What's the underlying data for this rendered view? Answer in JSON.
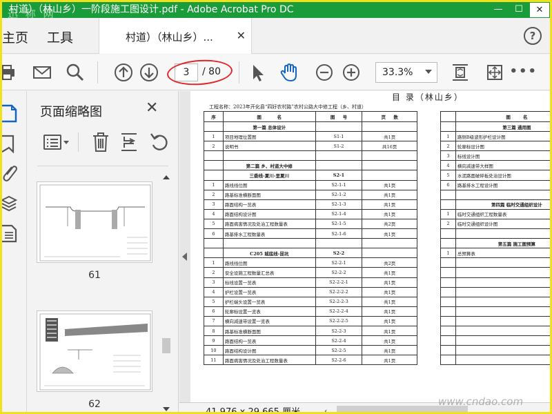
{
  "window": {
    "title": "村道）（林山乡）一阶段施工图设计.pdf - Adobe Acrobat Pro DC",
    "watermark": "迅 称 网",
    "minimize": "—",
    "maximize": "☐",
    "close": "✕",
    "accent": "#1a9c3a"
  },
  "tabs": {
    "home": "主页",
    "tools": "工具",
    "doc": "村道）（林山乡）...",
    "doc_close": "✕",
    "help": "?"
  },
  "toolbar": {
    "icons": [
      "print-icon",
      "email-icon",
      "search-icon",
      "page-up-icon",
      "page-down-icon",
      "select-cursor-icon",
      "hand-tool-icon",
      "zoom-out-icon",
      "zoom-in-icon",
      "fit-page-icon",
      "full-screen-icon",
      "more-icon"
    ],
    "page_current": "3",
    "page_total": "/ 80",
    "zoom": "33.3%",
    "more": "•••",
    "highlight_color": "#e0262a"
  },
  "thumbnails": {
    "header": "页面缩略图",
    "close": "✕",
    "tool_icons": [
      "options-icon",
      "delete-icon",
      "extract-icon",
      "rotate-icon"
    ],
    "pages": [
      {
        "label": "61"
      },
      {
        "label": "62"
      }
    ]
  },
  "document": {
    "heading": "目  录（林山乡）",
    "project_name": "工程名称：2023年开化县“四好农村路”农村公路大中修工程（乡、村道）",
    "left_table": {
      "headers": [
        "序",
        "图",
        "名",
        "图",
        "号",
        "页",
        "数"
      ],
      "rows": [
        {
          "type": "sec",
          "name": "第一篇  总体设计"
        },
        {
          "no": "1",
          "name": "项目地理位置图",
          "code": "S1-1",
          "pages": "共1页"
        },
        {
          "no": "2",
          "name": "说明书",
          "code": "S1-2",
          "pages": "共16页"
        },
        {
          "type": "blank"
        },
        {
          "type": "sec",
          "name": "第二篇  乡、村道大中修"
        },
        {
          "type": "sub",
          "name": "三委线-夏川-里夏川",
          "code": "S2-1"
        },
        {
          "no": "1",
          "name": "路线线位图",
          "code": "S2-1-1",
          "pages": "共1页"
        },
        {
          "no": "2",
          "name": "路基标准横断面图",
          "code": "S2-1-2",
          "pages": "共1页"
        },
        {
          "no": "3",
          "name": "路面结构一览表",
          "code": "S2-1-3",
          "pages": "共1页"
        },
        {
          "no": "4",
          "name": "路面结构设计图",
          "code": "S2-1-4",
          "pages": "共1页"
        },
        {
          "no": "5",
          "name": "路面病害情况及处治工程数量表",
          "code": "S2-1-5",
          "pages": "共2页"
        },
        {
          "no": "6",
          "name": "路基排水工程数量表",
          "code": "S2-1-6",
          "pages": "共1页"
        },
        {
          "type": "blank"
        },
        {
          "type": "sub",
          "name": "C205  城底线-昆坑",
          "code": "S2-2"
        },
        {
          "no": "1",
          "name": "路线线位图",
          "code": "S2-2-1",
          "pages": "共2页"
        },
        {
          "no": "2",
          "name": "安全设施工程数量汇总表",
          "code": "S2-2-2",
          "pages": "共1页"
        },
        {
          "no": "3",
          "name": "标线设置一览表",
          "code": "S2-2-2-1",
          "pages": "共1页"
        },
        {
          "no": "4",
          "name": "护栏设置一览表",
          "code": "S2-2-2-2",
          "pages": "共1页"
        },
        {
          "no": "5",
          "name": "护栏端头设置一览表",
          "code": "S2-2-2-3",
          "pages": "共1页"
        },
        {
          "no": "6",
          "name": "轮廓标设置一览表",
          "code": "S2-2-2-4",
          "pages": "共1页"
        },
        {
          "no": "7",
          "name": "横向减速带设置一览表",
          "code": "S2-2-2-5",
          "pages": "共1页"
        },
        {
          "no": "8",
          "name": "路基标准横断面图",
          "code": "S2-2-3",
          "pages": "共1页"
        },
        {
          "no": "9",
          "name": "路面结构一览表",
          "code": "S2-2-4",
          "pages": "共1页"
        },
        {
          "no": "10",
          "name": "路面结构设计图",
          "code": "S2-2-5",
          "pages": "共1页"
        },
        {
          "no": "11",
          "name": "路面病害情况及处治工程数量表",
          "code": "S2-2-6",
          "pages": "共1页"
        }
      ]
    },
    "right_table": {
      "headers": [
        "",
        "图",
        "名"
      ],
      "rows": [
        {
          "type": "sec",
          "name": "第三篇  通用图"
        },
        {
          "no": "1",
          "name": "路侧B级波形护栏设计图"
        },
        {
          "no": "2",
          "name": "轮廓标设计图"
        },
        {
          "no": "3",
          "name": "标线设计图"
        },
        {
          "no": "4",
          "name": "横向减速带大样图"
        },
        {
          "no": "5",
          "name": "水泥路面破碎板处治设计图"
        },
        {
          "no": "6",
          "name": "路基排水工程设计图"
        },
        {
          "type": "blank"
        },
        {
          "type": "sec",
          "name": "第四篇  临时交通组织设计"
        },
        {
          "no": "1",
          "name": "临时交通组织工程数量表"
        },
        {
          "no": "2",
          "name": "临时交通组织设计图"
        },
        {
          "type": "blank"
        },
        {
          "type": "sec",
          "name": "第五篇  施工图预算"
        },
        {
          "no": "1",
          "name": "总预算表"
        },
        {
          "type": "blank"
        },
        {
          "type": "blank"
        },
        {
          "type": "blank"
        },
        {
          "type": "blank"
        },
        {
          "type": "blank"
        },
        {
          "type": "blank"
        },
        {
          "type": "blank"
        },
        {
          "type": "blank"
        },
        {
          "type": "blank"
        },
        {
          "type": "blank"
        },
        {
          "type": "blank"
        }
      ]
    }
  },
  "status": {
    "dimensions": "41.976 x 29.665 厘米",
    "scroll_left": "‹"
  },
  "site_watermark": "www.cndao.com"
}
